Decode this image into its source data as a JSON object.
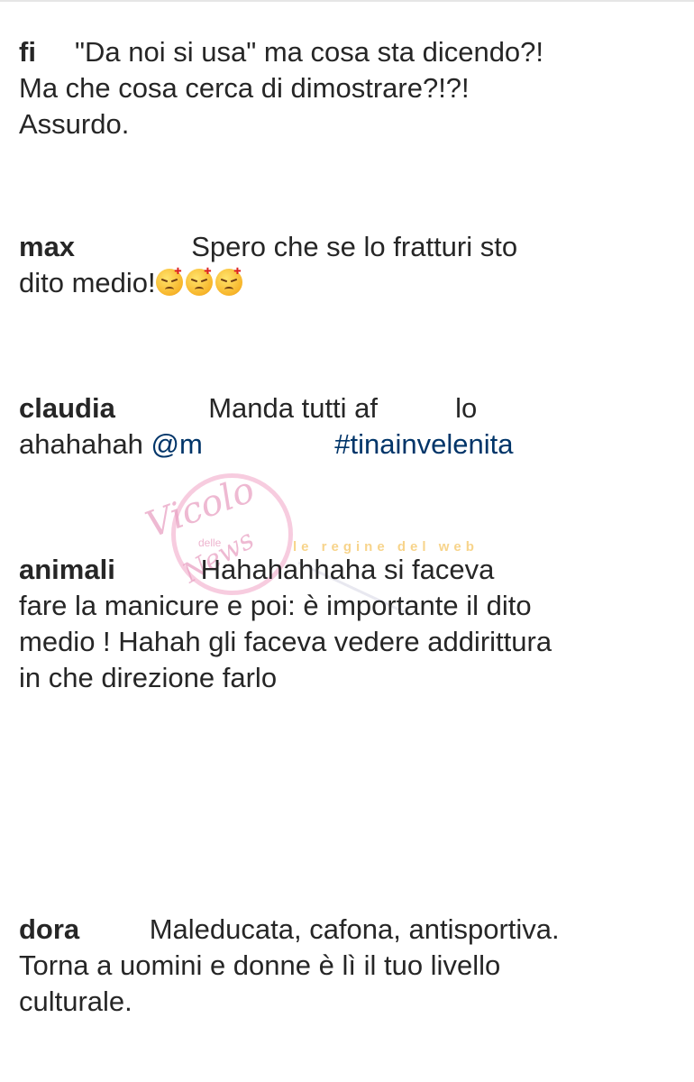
{
  "comments": [
    {
      "user": "fi",
      "gap": "     ",
      "line1": "\"Da noi si usa\" ma cosa sta dicendo?!",
      "line2": "Ma che cosa cerca di dimostrare?!?!",
      "line3": "Assurdo."
    },
    {
      "user": "max",
      "gap": "               ",
      "line1": "Spero che se lo fratturi sto",
      "line2": "dito medio!",
      "emoji": "angry-face-icon"
    },
    {
      "user": "claudia",
      "gap": "            ",
      "line1": "Manda tutti af",
      "gap2": "          ",
      "line1b": "lo",
      "line2": "ahahahah ",
      "mention": "@m",
      "gap3": "                 ",
      "hashtag": "#tinainvelenita"
    },
    {
      "user": "animali",
      "gap": "           ",
      "line1": "Hahahahhaha si faceva",
      "line2": "fare la manicure e poi: è importante il dito",
      "line3": "medio ! Hahah gli faceva vedere addirittura",
      "line4": "in che direzione farlo"
    },
    {
      "user": "dora",
      "gap": "         ",
      "line1": "Maleducata, cafona, antisportiva.",
      "line2": "Torna a uomini e donne è lì il tuo livello",
      "line3": "culturale."
    }
  ],
  "watermark": {
    "script": "Vicolo",
    "small": "delle",
    "script2": "News",
    "band": "le regine del web"
  },
  "colors": {
    "text": "#262626",
    "link": "#003569",
    "watermark_pink": "#f4b6d2",
    "watermark_gold": "#f5c25b"
  }
}
